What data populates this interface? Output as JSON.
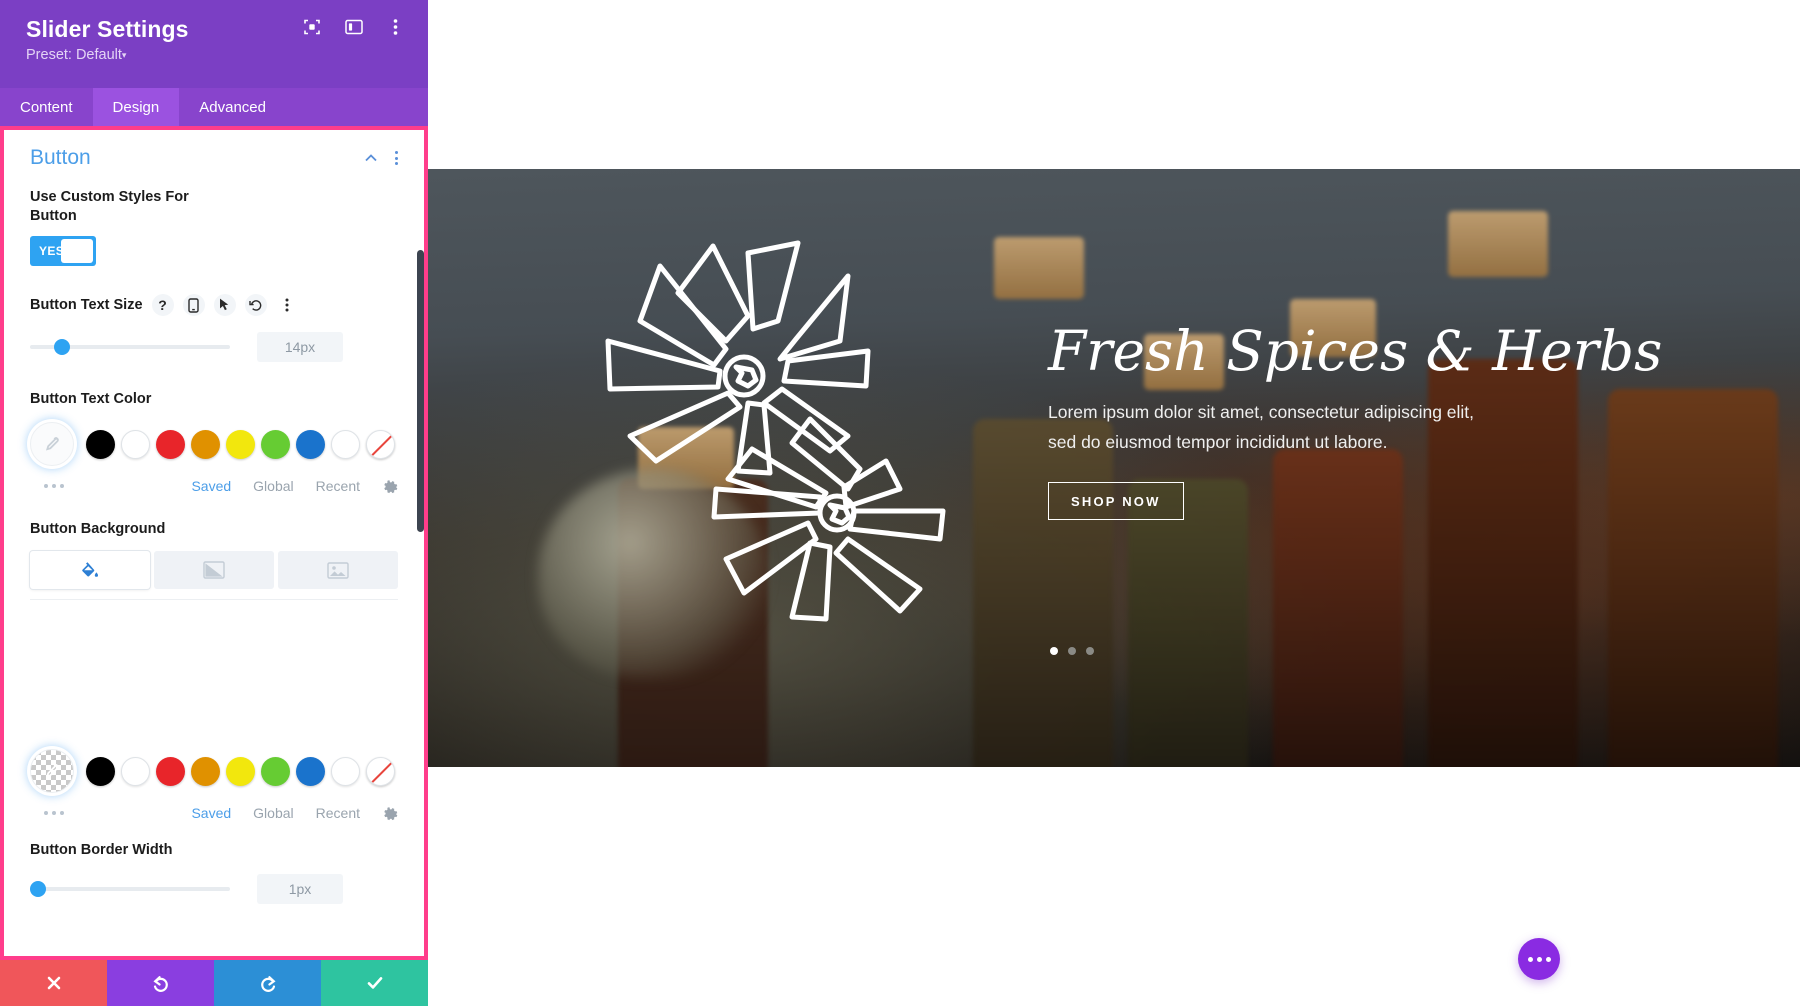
{
  "panel": {
    "title": "Slider Settings",
    "preset": "Preset: Default",
    "preset_caret": "▾",
    "header_icons": [
      {
        "name": "focus-icon"
      },
      {
        "name": "layout-panel-icon"
      },
      {
        "name": "more-vertical-icon"
      }
    ],
    "tabs": [
      {
        "label": "Content",
        "active": false
      },
      {
        "label": "Design",
        "active": true
      },
      {
        "label": "Advanced",
        "active": false
      }
    ],
    "section": {
      "title": "Button",
      "collapse_icon": "chevron-up-icon",
      "overflow_icon": "more-vertical-icon"
    },
    "custom_styles": {
      "label": "Use Custom Styles For Button",
      "toggle_value": "YES"
    },
    "text_size": {
      "label": "Button Text Size",
      "help_icon": "?",
      "icons": [
        "help-icon",
        "responsive-icon",
        "hover-icon",
        "reset-icon",
        "more-icon"
      ],
      "value": "14px",
      "slider_percent": 16
    },
    "text_color": {
      "label": "Button Text Color",
      "selected_swatch": "eyedropper",
      "swatches": [
        "#000000",
        "#ffffff",
        "#e8252a",
        "#e09100",
        "#f2e70d",
        "#66cc33",
        "#1a73cc",
        "#ffffff",
        "none"
      ],
      "links": [
        {
          "label": "Saved",
          "active": true
        },
        {
          "label": "Global",
          "active": false
        },
        {
          "label": "Recent",
          "active": false
        }
      ],
      "settings_icon": "gear-icon"
    },
    "button_background": {
      "label": "Button Background",
      "tabs": [
        {
          "name": "solid-color-tab",
          "icon": "paint-bucket-icon",
          "active": true
        },
        {
          "name": "gradient-tab",
          "icon": "gradient-icon",
          "active": false
        },
        {
          "name": "image-tab",
          "icon": "image-icon",
          "active": false
        }
      ],
      "selected_swatch": "transparent-checker",
      "swatches": [
        "#000000",
        "#ffffff",
        "#e8252a",
        "#e09100",
        "#f2e70d",
        "#66cc33",
        "#1a73cc",
        "#ffffff",
        "none"
      ],
      "links": [
        {
          "label": "Saved",
          "active": true
        },
        {
          "label": "Global",
          "active": false
        },
        {
          "label": "Recent",
          "active": false
        }
      ],
      "settings_icon": "gear-icon"
    },
    "border_width": {
      "label": "Button Border Width",
      "value": "1px",
      "slider_percent": 4
    },
    "footer": [
      {
        "name": "cancel-button",
        "icon": "close-icon",
        "color": "#f0565a"
      },
      {
        "name": "undo-button",
        "icon": "undo-icon",
        "color": "#8a3ee0"
      },
      {
        "name": "redo-button",
        "icon": "redo-icon",
        "color": "#2c8fd6"
      },
      {
        "name": "save-button",
        "icon": "check-icon",
        "color": "#2ec4a0"
      }
    ],
    "highlight_border_color": "#ff3d8b"
  },
  "preview": {
    "slide": {
      "title": "Fresh Spices & Herbs",
      "desc_line1": "Lorem ipsum dolor sit amet, consectetur adipiscing elit,",
      "desc_line2": "sed do eiusmod tempor incididunt ut labore.",
      "cta_label": "SHOP NOW",
      "dots": [
        true,
        false,
        false
      ]
    },
    "fab": {
      "name": "page-settings-fab",
      "icon": "more-horizontal-icon",
      "color": "#8a2be2"
    }
  }
}
